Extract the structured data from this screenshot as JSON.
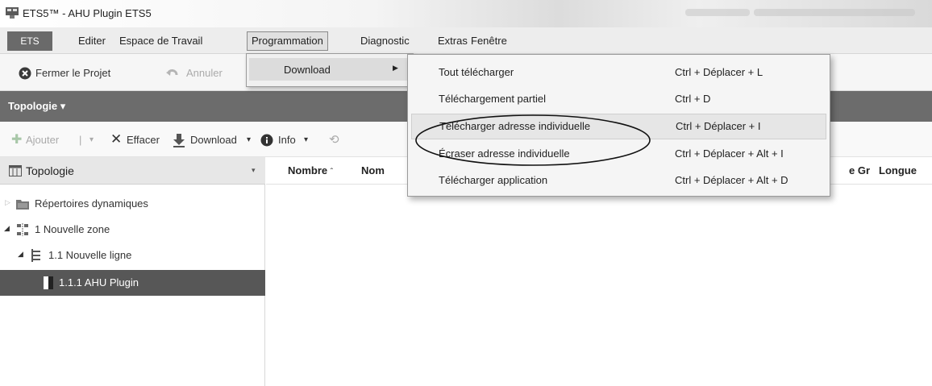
{
  "window": {
    "title": "ETS5™ - AHU Plugin ETS5"
  },
  "menubar": {
    "ets": "ETS",
    "items": [
      "Editer",
      "Espace de Travail",
      "Programmation",
      "Diagnostic",
      "Extras",
      "Fenêtre"
    ]
  },
  "toolbar": {
    "close_project": "Fermer le Projet",
    "undo": "Annuler"
  },
  "topology_bar": {
    "label": "Topologie ▾"
  },
  "toolbar2": {
    "add": "Ajouter",
    "delete": "Effacer",
    "download": "Download",
    "info": "Info"
  },
  "panel": {
    "header": "Topologie",
    "tree": [
      {
        "label": "Répertoires dynamiques",
        "icon": "folder-icon"
      },
      {
        "label": "1 Nouvelle zone",
        "icon": "zone-icon"
      },
      {
        "label": "1.1 Nouvelle ligne",
        "icon": "line-icon"
      },
      {
        "label": "1.1.1 AHU Plugin",
        "icon": "device-icon",
        "selected": true
      }
    ]
  },
  "grid": {
    "columns": [
      "Nombre",
      "Nom",
      "e Gr",
      "Longue"
    ]
  },
  "submenu": {
    "download": "Download"
  },
  "dropdown": {
    "items": [
      {
        "label": "Tout télécharger",
        "shortcut": "Ctrl + Déplacer + L"
      },
      {
        "label": "Téléchargement partiel",
        "shortcut": "Ctrl + D"
      },
      {
        "label": "Télécharger adresse individuelle",
        "shortcut": "Ctrl + Déplacer + I",
        "highlighted": true
      },
      {
        "label": "Écraser adresse individuelle",
        "shortcut": "Ctrl + Déplacer + Alt + I"
      },
      {
        "label": "Télécharger application",
        "shortcut": "Ctrl + Déplacer + Alt + D"
      }
    ]
  }
}
